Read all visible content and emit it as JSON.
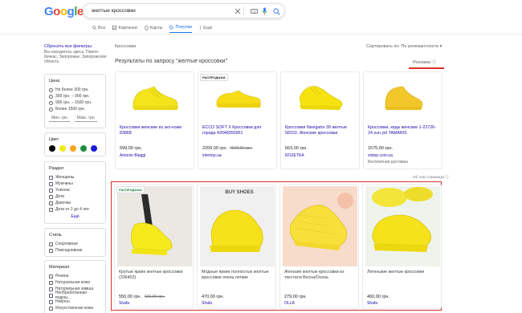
{
  "header": {
    "logo": [
      {
        "ch": "G",
        "color": "#4285F4"
      },
      {
        "ch": "o",
        "color": "#EA4335"
      },
      {
        "ch": "o",
        "color": "#FBBC05"
      },
      {
        "ch": "g",
        "color": "#4285F4"
      },
      {
        "ch": "l",
        "color": "#34A853"
      },
      {
        "ch": "e",
        "color": "#EA4335"
      }
    ],
    "query": "желтые кроссовки",
    "tabs": [
      "Все",
      "Картинки",
      "Карты",
      "Покупки",
      "Ещё"
    ],
    "active_tab": "Покупки"
  },
  "sidebar": {
    "reset": "Сбросить все фильтры",
    "location": "Вы находитесь здесь: Павло-Кичкас, Запорожье, Запорожская область",
    "price": {
      "title": "Цена",
      "options": [
        "Не более 300 грн.",
        "300 грн. – 900 грн.",
        "900 грн. – 1500 грн.",
        "Более 1500 грн."
      ],
      "min": "Мин. грн",
      "max": "Макс. грн"
    },
    "color": {
      "title": "Цвет",
      "swatches": [
        "#000000",
        "#f2ea17",
        "#f5a623",
        "#1e8e3e",
        "#1a1ad6"
      ]
    },
    "section": {
      "title": "Раздел",
      "options": [
        "Женщины",
        "Мужчины",
        "Унисекс",
        "Дети",
        "Девочки",
        "Дети от 2 до 4 лет"
      ],
      "more": "Ещё"
    },
    "style": {
      "title": "Стиль",
      "options": [
        "Спортивная",
        "Повседневная"
      ]
    },
    "material": {
      "title": "Материал",
      "options": [
        "Резина",
        "Натуральная кожа",
        "Натуральная замша",
        "Необработанная подош...",
        "Нейлон",
        "Искусственная кожа"
      ]
    }
  },
  "main": {
    "breadcrumb": "Кроссовки",
    "sort": "Сортировать по: По релевантности",
    "results_title": "Результаты по запросу \"желтые кроссовки\"",
    "ads_label": "Реклама ⓘ",
    "footnote": "Об этих страницах ⓘ",
    "row1": [
      {
        "title": "Кроссовки женские из эко-кожи 83868",
        "price": "599,00 грн.",
        "old_price": "",
        "store": "Antonio Biaggi",
        "shipping": "",
        "badge": ""
      },
      {
        "title": "ECCO SOFT X Кроссовки для города 42048350951",
        "price": "2209,00 грн.",
        "old_price": "4509,00 грн.",
        "store": "intertop.ua",
        "shipping": "",
        "badge": "РАСПРОДАЖА"
      },
      {
        "title": "Кроссовки Navigator 39 желтые 58153. Женские кроссовки",
        "price": "663,00 грн.",
        "old_price": "",
        "store": "ROZETKA",
        "shipping": "",
        "badge": ""
      },
      {
        "title": "Кроссовки, кеды женские 1-23726-24 sun уel TAMARIS",
        "price": "1575,00 грн.",
        "old_price": "",
        "store": "vlstop.com.ua",
        "shipping": "Бесплатная доставка",
        "badge": ""
      }
    ],
    "row2": [
      {
        "title": "Крутые яркие желтые кроссовки (336403)",
        "price": "550,00 грн.",
        "old_price": "600,00 грн.",
        "store": "Shafa",
        "badge": "РАСПРОДАЖА",
        "img_text": ""
      },
      {
        "title": "Модные яркие полностью желтые кроссовки очень легкие",
        "price": "470,00 грн.",
        "old_price": "",
        "store": "Shafa",
        "badge": "",
        "img_text": "BUY SHOES"
      },
      {
        "title": "Женские желтые кроссовки из текстиля Весна/Осень",
        "price": "279,00 грн.",
        "old_price": "",
        "store": "OLLA",
        "badge": "",
        "img_text": ""
      },
      {
        "title": "Легенькие желтые кроссовки",
        "price": "460,00 грн.",
        "old_price": "",
        "store": "Shafa",
        "badge": "",
        "img_text": ""
      }
    ]
  },
  "colors": {
    "accent_blue": "#1a73e8",
    "link": "#1a0dab",
    "highlight_red": "#d93025",
    "product_yellow": "#f4e21a"
  }
}
